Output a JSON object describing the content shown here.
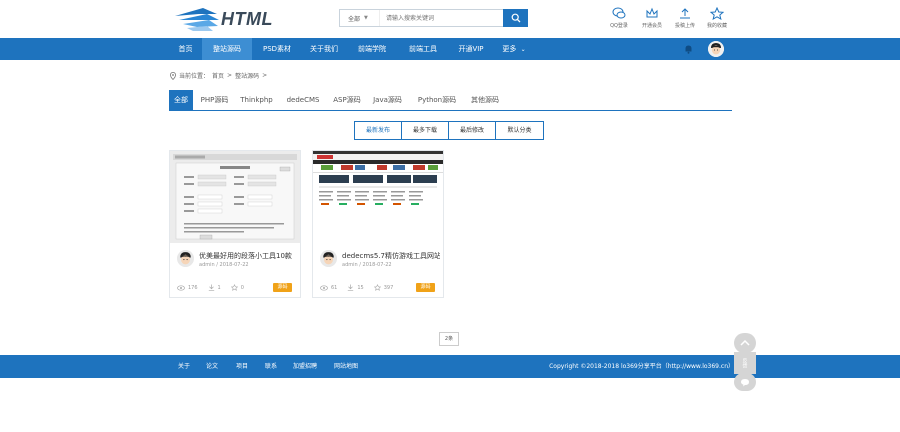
{
  "header": {
    "logo_text": "HTML",
    "search_type": "全部",
    "search_placeholder": "请输入搜索关键词",
    "tools": [
      {
        "label": "QQ登录",
        "icon": "chat-bubble-icon"
      },
      {
        "label": "开通会员",
        "icon": "crown-icon"
      },
      {
        "label": "投稿上传",
        "icon": "upload-icon"
      },
      {
        "label": "我的收藏",
        "icon": "star-icon"
      }
    ]
  },
  "nav": {
    "items": [
      "首页",
      "整站源码",
      "PSD素材",
      "关于我们",
      "前端学院",
      "前端工具",
      "开通VIP",
      "更多"
    ],
    "active_index": 1
  },
  "breadcrumb": {
    "prefix": "当前位置：",
    "home": "首页",
    "sep": ">",
    "current": "整站源码",
    "trail": ">"
  },
  "categories": {
    "items": [
      "全部",
      "PHP源码",
      "Thinkphp",
      "dedeCMS",
      "ASP源码",
      "Java源码",
      "Python源码",
      "其他源码"
    ],
    "active_index": 0
  },
  "sort": {
    "items": [
      "最新发布",
      "最多下载",
      "最后修改",
      "默认分类"
    ],
    "active_index": 0
  },
  "cards": [
    {
      "title": "优美最好用的段落小工具10款",
      "author": "admin",
      "date": "2018-07-22",
      "views": "176",
      "downloads": "1",
      "favorites": "0",
      "badge": "源码"
    },
    {
      "title": "dedecms5.7精仿游戏工具网站",
      "author": "admin",
      "date": "2018-07-22",
      "views": "61",
      "downloads": "15",
      "favorites": "397",
      "badge": "源码"
    }
  ],
  "pagination": {
    "label": "2条"
  },
  "footer": {
    "links": [
      "关于",
      "论文",
      "项目",
      "联系",
      "加盟招聘",
      "网站地图"
    ],
    "copyright": "Copyright ©2018-2018 lo369分享平台（http://www.lo369.cn）"
  },
  "float_bar": {
    "top_label": "Top",
    "feedback_label": "反馈"
  },
  "colors": {
    "primary": "#1e73be",
    "accent": "#f0a218"
  }
}
